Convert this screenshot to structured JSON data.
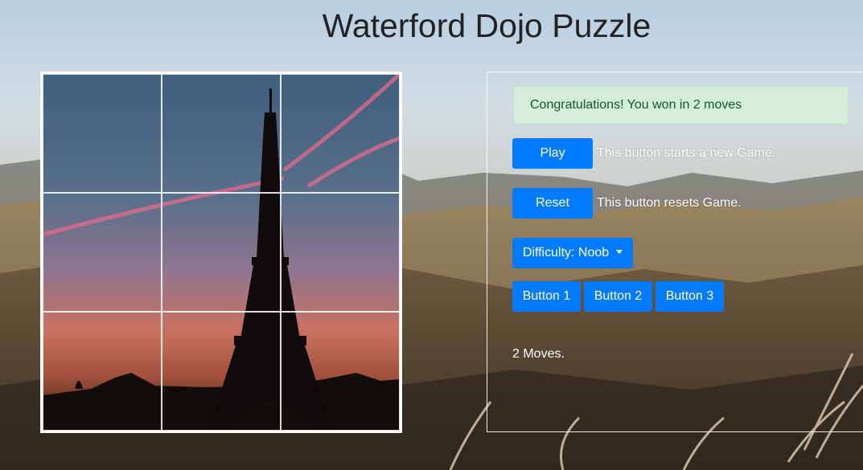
{
  "page": {
    "title": "Waterford Dojo Puzzle"
  },
  "puzzle": {
    "image_subject": "Eiffel Tower at sunset",
    "rows": 3,
    "cols": 3,
    "solved": true
  },
  "alert": {
    "text": "Congratulations! You won in 2 moves",
    "color": "#d4edda"
  },
  "controls": {
    "play_label": "Play",
    "play_desc": "This button starts a new Game.",
    "reset_label": "Reset",
    "reset_desc": "This button resets Game.",
    "difficulty_label": "Difficulty: Noob",
    "button1_label": "Button 1",
    "button2_label": "Button 2",
    "button3_label": "Button 3",
    "accent_color": "#007bff"
  },
  "status": {
    "moves_text": "2 Moves."
  }
}
